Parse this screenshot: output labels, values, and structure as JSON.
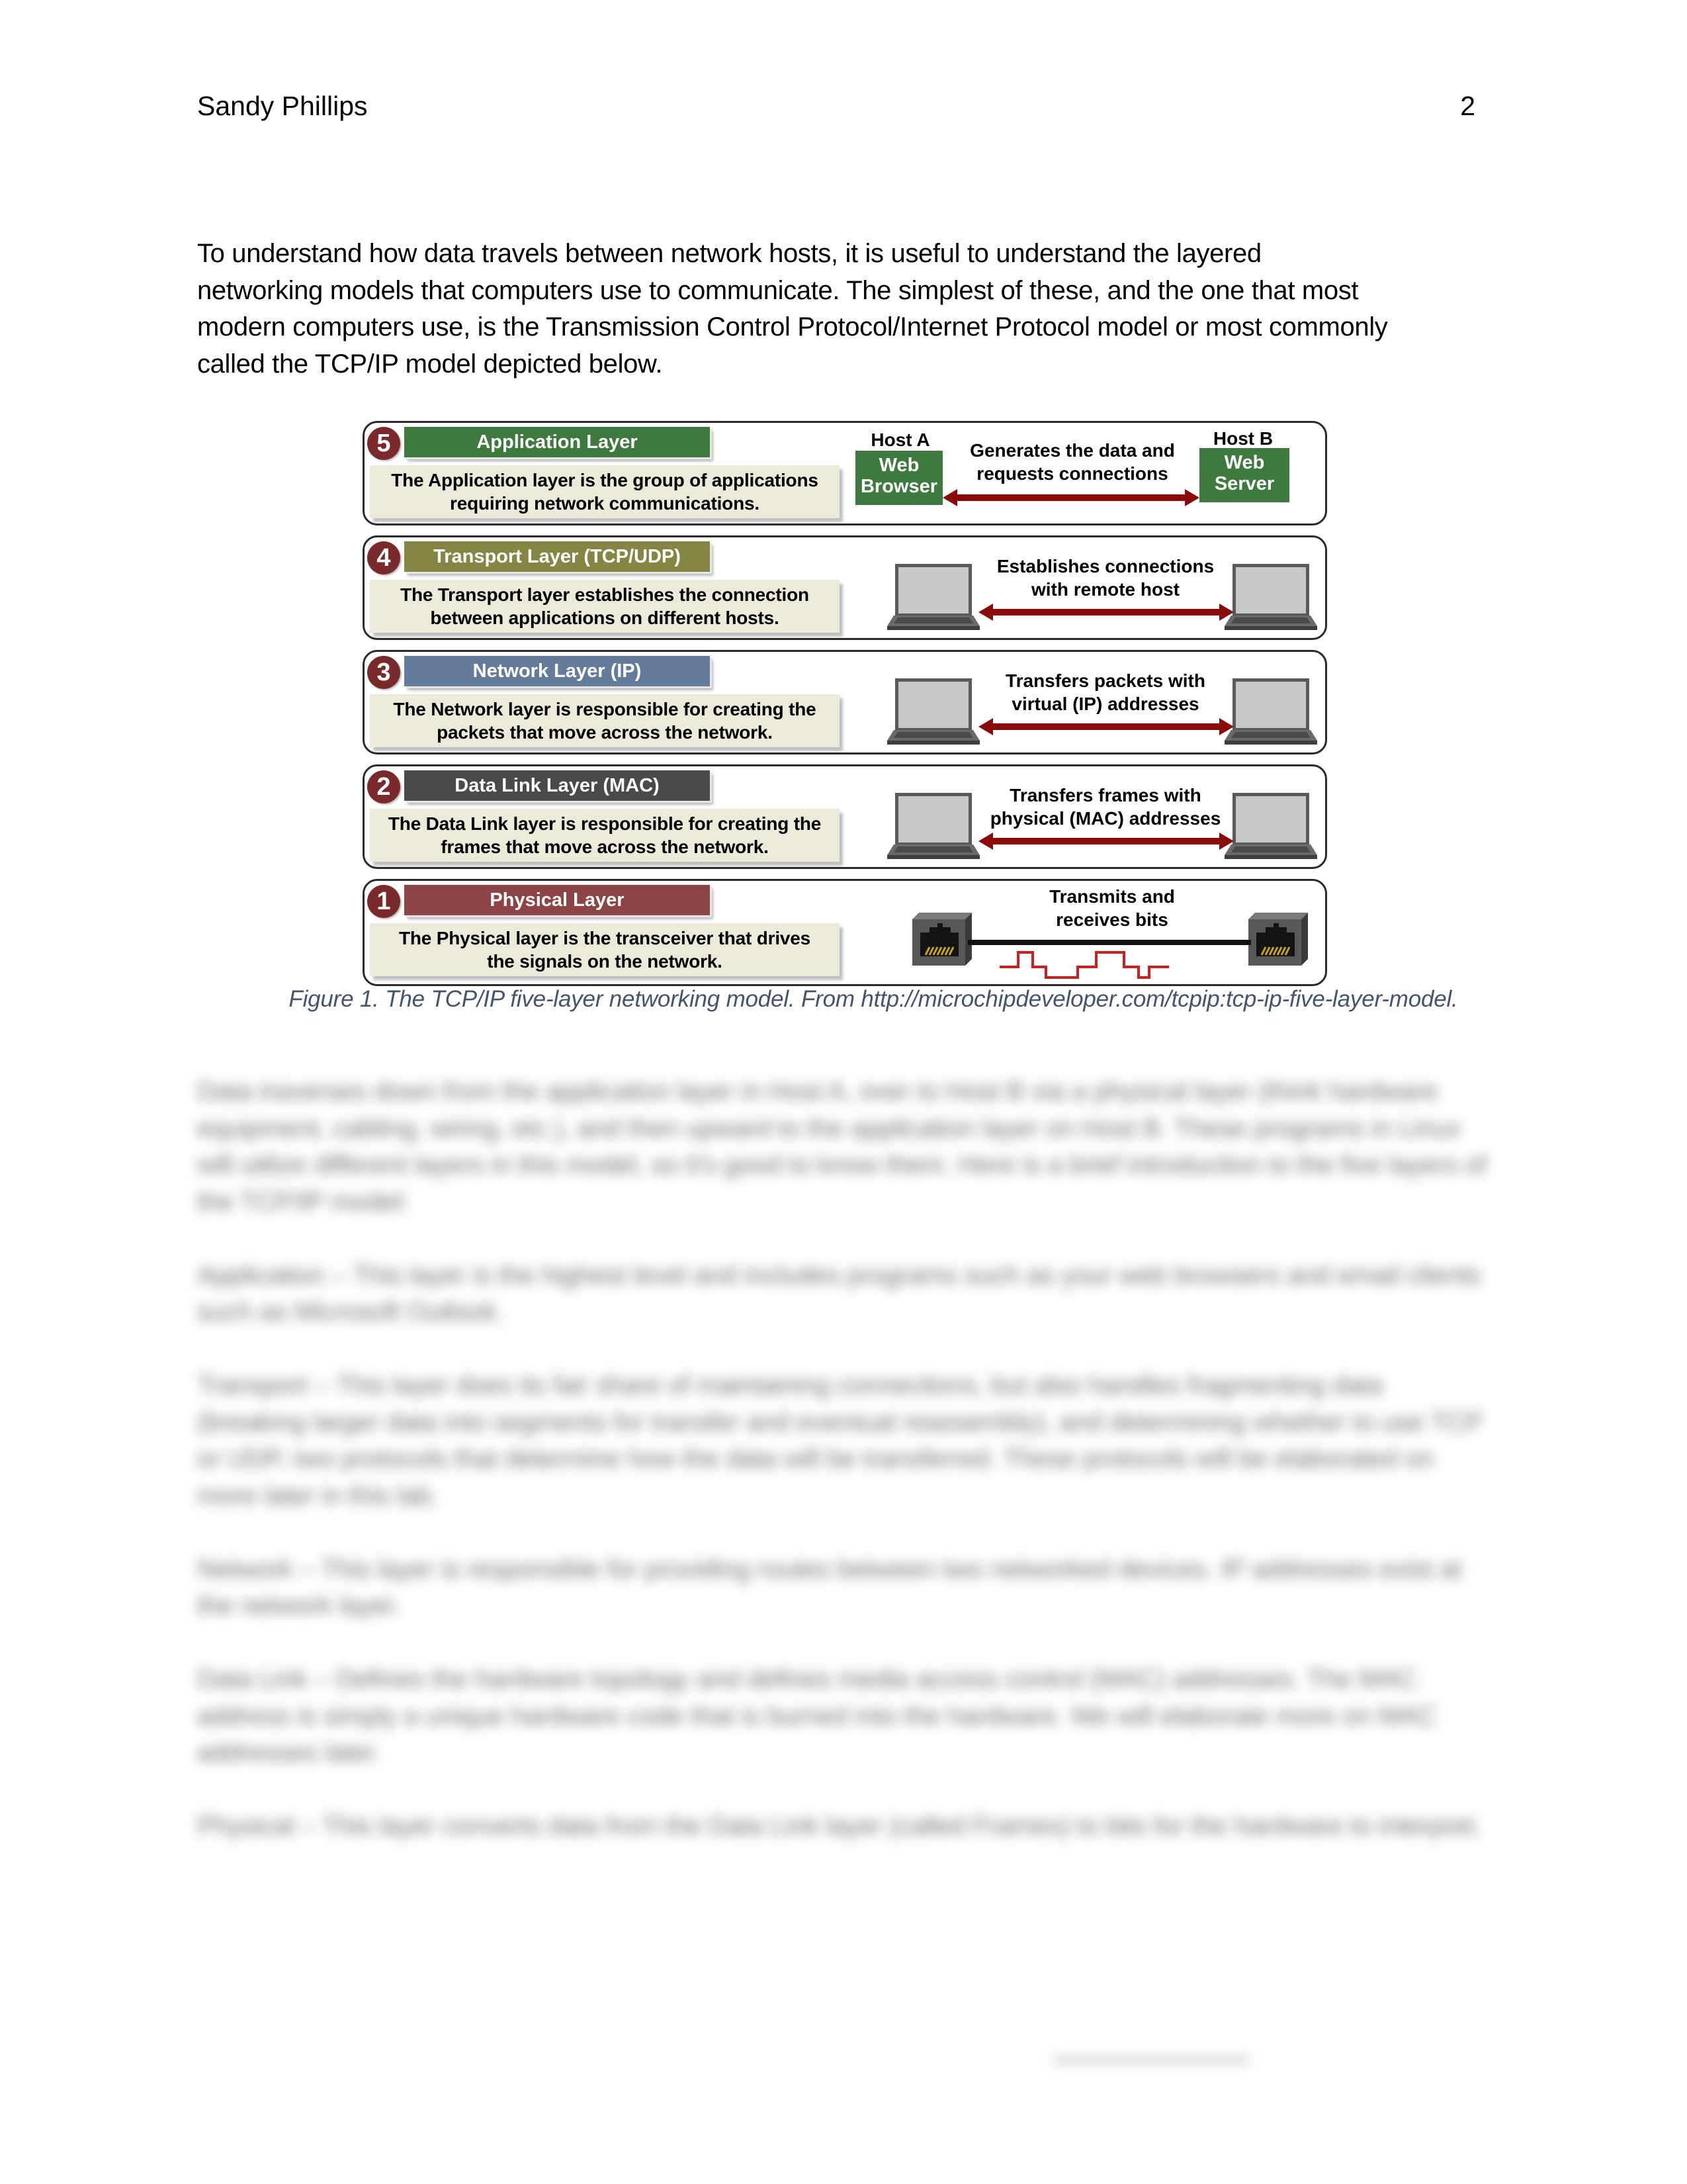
{
  "header": {
    "author": "Sandy Phillips",
    "page_number": "2"
  },
  "intro": {
    "lines": [
      "To understand how data travels between network hosts, it is useful to understand the layered",
      "networking models that computers use to communicate. The simplest of these, and the one that most",
      "modern computers use, is the Transmission Control Protocol/Internet Protocol model or most commonly",
      "called the TCP/IP model depicted below."
    ]
  },
  "figure": {
    "layers": [
      {
        "number": "5",
        "title": "Application Layer",
        "title_color": "#3e7a3e",
        "desc_line1": "The Application layer is the group of applications",
        "desc_line2": "requiring network communications.",
        "right_line1": "Generates the data and",
        "right_line2": "requests connections",
        "host_a_label": "Host A",
        "host_a_line1": "Web",
        "host_a_line2": "Browser",
        "host_b_label": "Host B",
        "host_b_line1": "Web",
        "host_b_line2": "Server",
        "device": "web-app-box"
      },
      {
        "number": "4",
        "title": "Transport Layer (TCP/UDP)",
        "title_color": "#858544",
        "desc_line1": "The Transport layer establishes the connection",
        "desc_line2": "between applications on different hosts.",
        "right_line1": "Establishes connections",
        "right_line2": "with remote host",
        "device": "laptop-icon"
      },
      {
        "number": "3",
        "title": "Network Layer (IP)",
        "title_color": "#647c9c",
        "desc_line1": "The Network layer is responsible for creating the",
        "desc_line2": "packets that move across the network.",
        "right_line1": "Transfers packets with",
        "right_line2": "virtual (IP) addresses",
        "device": "laptop-icon"
      },
      {
        "number": "2",
        "title": "Data Link Layer (MAC)",
        "title_color": "#4a4a4a",
        "desc_line1": "The Data Link layer is responsible for creating the",
        "desc_line2": "frames that move across the network.",
        "right_line1": "Transfers frames with",
        "right_line2": "physical (MAC) addresses",
        "device": "laptop-icon"
      },
      {
        "number": "1",
        "title": "Physical Layer",
        "title_color": "#8c4444",
        "desc_line1": "The Physical layer is the transceiver that drives",
        "desc_line2": "the signals on the network.",
        "right_line1": "Transmits and",
        "right_line2": "receives bits",
        "device": "ethernet-jack-icon"
      }
    ],
    "colors": {
      "number_badge": "#7a2a2a",
      "arrow": "#8b0a0a",
      "desc_bg": "#ecead9",
      "signal": "#cc1f1f"
    },
    "caption": "Figure 1. The TCP/IP five-layer networking model. From http://microchipdeveloper.com/tcpip:tcp-ip-five-layer-model."
  },
  "blurred_body": {
    "paragraphs": [
      "Data traverses down from the application layer in Host A, over to Host B via a physical layer (think hardware equipment, cabling, wiring, etc.), and then upward to the application layer on Host B. These programs in Linux will utilize different layers in this model, so it's good to know them. Here is a brief introduction to the five layers of the TCP/IP model:",
      "Application – This layer is the highest level and includes programs such as your web browsers and email clients such as Microsoft Outlook.",
      "Transport – This layer does its fair share of maintaining connections, but also handles fragmenting data (breaking larger data into segments for transfer and eventual reassembly), and determining whether to use TCP or UDP, two protocols that determine how the data will be transferred. These protocols will be elaborated on more later in this lab.",
      "Network – This layer is responsible for providing routes between two networked devices. IP addresses exist at the network layer.",
      "Data Link – Defines the hardware topology and defines media access control (MAC) addresses. The MAC address is simply a unique hardware code that is burned into the hardware. We will elaborate more on MAC addresses later.",
      "Physical – This layer converts data from the Data Link layer (called Frames) to bits for the hardware to interpret."
    ]
  }
}
